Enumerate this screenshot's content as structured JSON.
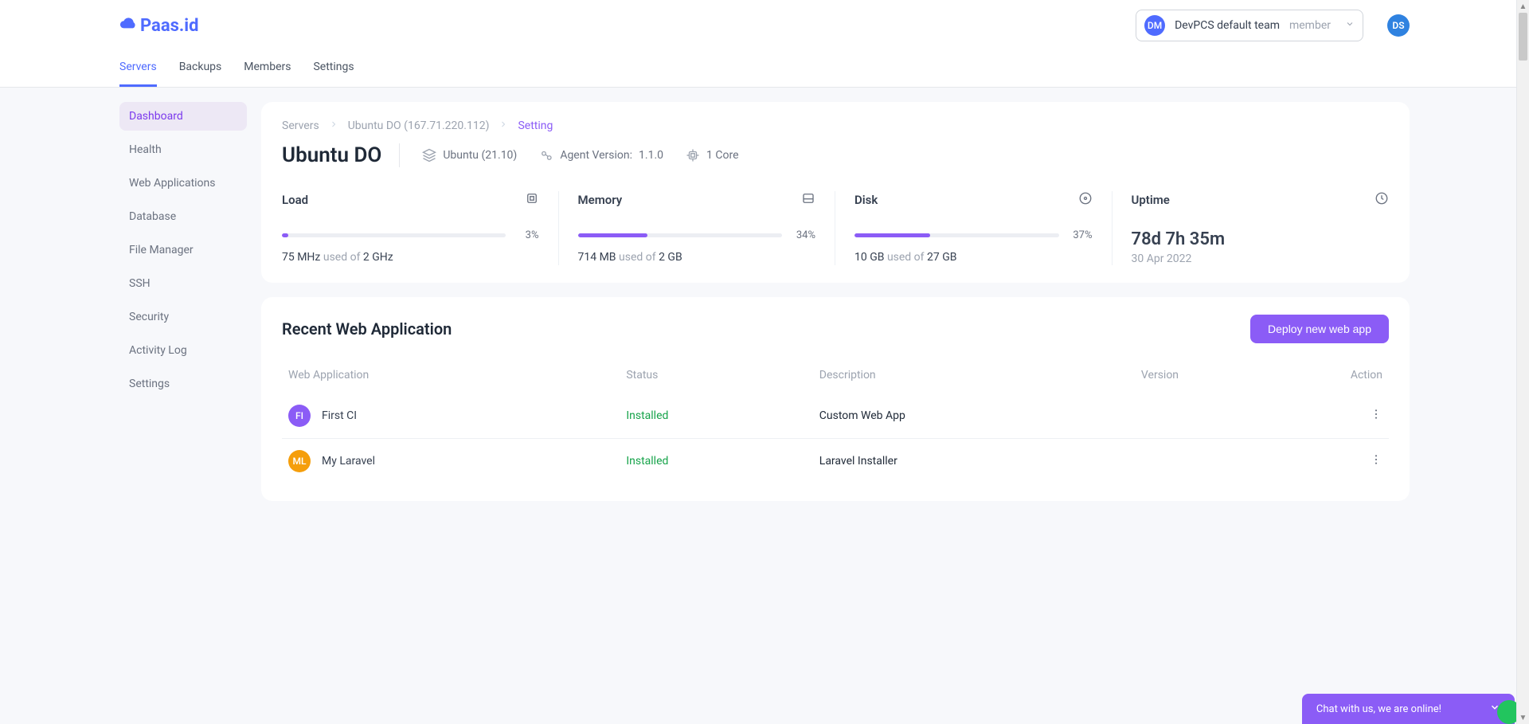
{
  "brand": "Paas.id",
  "team": {
    "avatar": "DM",
    "name": "DevPCS default team",
    "role": "member"
  },
  "user_avatar": "DS",
  "tabs": [
    "Servers",
    "Backups",
    "Members",
    "Settings"
  ],
  "active_tab": 0,
  "sidebar": [
    "Dashboard",
    "Health",
    "Web Applications",
    "Database",
    "File Manager",
    "SSH",
    "Security",
    "Activity Log",
    "Settings"
  ],
  "active_side": 0,
  "breadcrumb": {
    "root": "Servers",
    "server": "Ubuntu DO (167.71.220.112)",
    "leaf": "Setting"
  },
  "server": {
    "name": "Ubuntu DO",
    "os": "Ubuntu (21.10)",
    "agent_label": "Agent Version:",
    "agent_version": "1.1.0",
    "cores": "1 Core"
  },
  "stats": {
    "load": {
      "label": "Load",
      "pct": 3,
      "text": {
        "a": "75 MHz",
        "mid": " used of ",
        "b": "2 GHz"
      }
    },
    "memory": {
      "label": "Memory",
      "pct": 34,
      "text": {
        "a": "714 MB",
        "mid": " used of ",
        "b": "2 GB"
      }
    },
    "disk": {
      "label": "Disk",
      "pct": 37,
      "text": {
        "a": "10 GB",
        "mid": " used of ",
        "b": "27 GB"
      }
    },
    "uptime": {
      "label": "Uptime",
      "value": "78d 7h 35m",
      "date": "30 Apr 2022"
    }
  },
  "apps": {
    "heading": "Recent Web Application",
    "deploy_btn": "Deploy new web app",
    "cols": {
      "name": "Web Application",
      "status": "Status",
      "desc": "Description",
      "version": "Version",
      "action": "Action"
    },
    "rows": [
      {
        "initials": "FI",
        "color": "#8b5cf6",
        "name": "First CI",
        "status": "Installed",
        "desc": "Custom Web App",
        "version": ""
      },
      {
        "initials": "ML",
        "color": "#f59e0b",
        "name": "My Laravel",
        "status": "Installed",
        "desc": "Laravel Installer",
        "version": ""
      }
    ]
  },
  "chat": "Chat with us, we are online!"
}
